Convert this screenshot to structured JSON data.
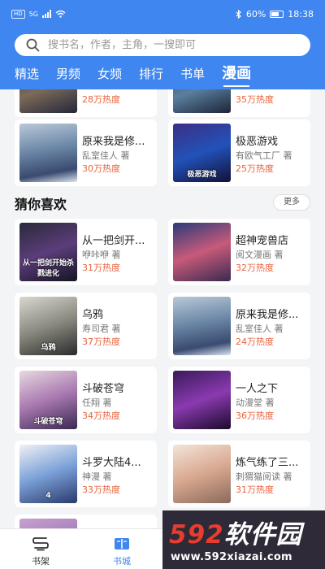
{
  "status_bar": {
    "network": "HD",
    "signal": "5G",
    "battery": "60%",
    "time": "18:38"
  },
  "search": {
    "placeholder": "搜书名，作者，主角，一搜即可"
  },
  "tabs": [
    {
      "label": "精选"
    },
    {
      "label": "男频"
    },
    {
      "label": "女频"
    },
    {
      "label": "排行"
    },
    {
      "label": "书单"
    },
    {
      "label": "漫画",
      "active": true
    }
  ],
  "top_section": {
    "partial_cards": [
      {
        "heat": "28万热度"
      },
      {
        "heat": "35万热度"
      }
    ],
    "cards": [
      {
        "title": "原来我是修...",
        "author": "乱室佳人 著",
        "heat": "30万热度"
      },
      {
        "title": "极恶游戏",
        "author": "有欧气工厂 著",
        "heat": "25万热度",
        "cover_text": "极恶游戏"
      }
    ]
  },
  "guess": {
    "title": "猜你喜欢",
    "more_label": "更多",
    "cards": [
      {
        "title": "从一把剑开...",
        "author": "咿咔咿 著",
        "heat": "31万热度",
        "cover_text": "从一把剑开始杀戮进化"
      },
      {
        "title": "超神宠兽店",
        "author": "阅文漫画 著",
        "heat": "32万热度"
      },
      {
        "title": "乌鸦",
        "author": "寿司君 著",
        "heat": "37万热度",
        "cover_text": "乌鸦"
      },
      {
        "title": "原来我是修...",
        "author": "乱室佳人 著",
        "heat": "24万热度"
      },
      {
        "title": "斗破苍穹",
        "author": "任翔 著",
        "heat": "34万热度",
        "cover_text": "斗破苍穹"
      },
      {
        "title": "一人之下",
        "author": "动漫堂 著",
        "heat": "36万热度"
      },
      {
        "title": "斗罗大陆4...",
        "author": "神漫 著",
        "heat": "33万热度",
        "cover_text": "4"
      },
      {
        "title": "炼气练了三...",
        "author": "刺猬猫阅读 著",
        "heat": "31万热度"
      }
    ]
  },
  "bottom_nav": [
    {
      "label": "书架",
      "icon": "bookshelf-icon"
    },
    {
      "label": "书城",
      "icon": "bookstore-icon",
      "active": true
    }
  ],
  "watermark": {
    "logo_prefix": "592",
    "logo_suffix": "软件园",
    "url": "www.592xiazai.com"
  },
  "colors": {
    "accent": "#3f86f0",
    "heat": "#e8633d",
    "background": "#f3f4f6"
  }
}
